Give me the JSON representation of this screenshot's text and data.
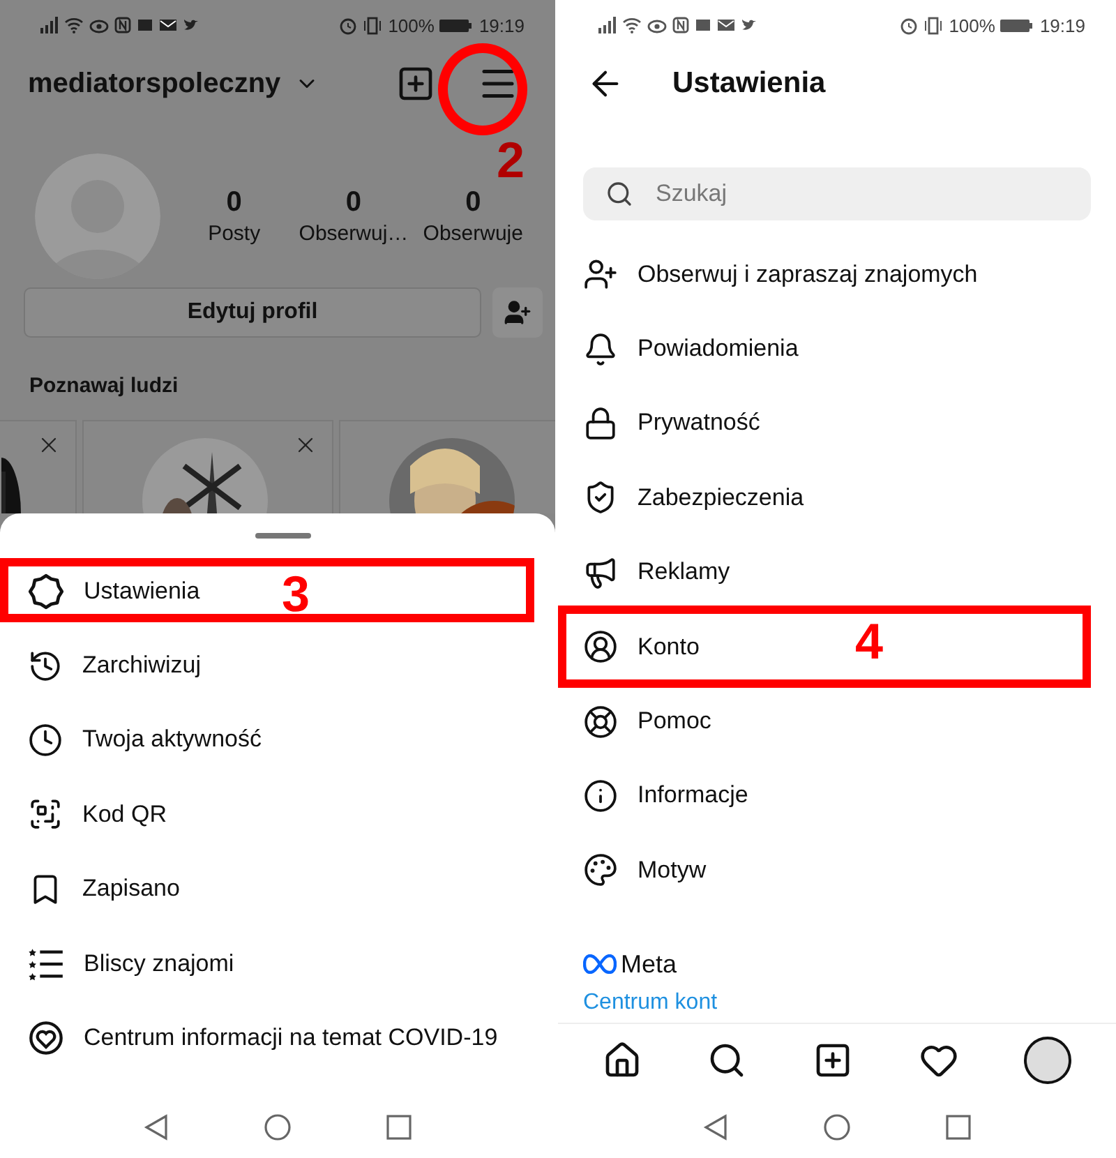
{
  "left_screen": {
    "status_bar": {
      "battery": "100%",
      "time": "19:19"
    },
    "header": {
      "username": "mediatorspoleczny",
      "annotation": "2"
    },
    "stats": [
      {
        "value": "0",
        "label": "Posty"
      },
      {
        "value": "0",
        "label": "Obserwuj…"
      },
      {
        "value": "0",
        "label": "Obserwuje"
      }
    ],
    "edit_button": "Edytuj profil",
    "suggestions_title": "Poznawaj ludzi",
    "menu_sheet": {
      "items": [
        {
          "label": "Ustawienia",
          "annotation": "3"
        },
        {
          "label": "Zarchiwizuj"
        },
        {
          "label": "Twoja aktywność"
        },
        {
          "label": "Kod QR"
        },
        {
          "label": "Zapisano"
        },
        {
          "label": "Bliscy znajomi"
        },
        {
          "label": "Centrum informacji na temat COVID-19"
        }
      ]
    }
  },
  "right_screen": {
    "status_bar": {
      "battery": "100%",
      "time": "19:19"
    },
    "title": "Ustawienia",
    "search": {
      "placeholder": "Szukaj"
    },
    "items": [
      {
        "label": "Obserwuj i zapraszaj znajomych"
      },
      {
        "label": "Powiadomienia"
      },
      {
        "label": "Prywatność"
      },
      {
        "label": "Zabezpieczenia"
      },
      {
        "label": "Reklamy"
      },
      {
        "label": "Konto",
        "annotation": "4"
      },
      {
        "label": "Pomoc"
      },
      {
        "label": "Informacje"
      },
      {
        "label": "Motyw"
      }
    ],
    "brand": "Meta",
    "link": "Centrum kont"
  }
}
